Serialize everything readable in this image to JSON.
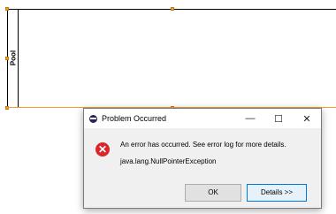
{
  "canvas": {
    "pool_label": "Pool"
  },
  "dialog": {
    "title": "Problem Occurred",
    "minimize_glyph": "—",
    "maximize_glyph": "☐",
    "close_glyph": "✕",
    "error_icon_glyph": "✕",
    "message": "An error has occurred. See error log for more details.",
    "exception": "java.lang.NullPointerException",
    "ok_label": "OK",
    "details_label": "Details >>"
  }
}
